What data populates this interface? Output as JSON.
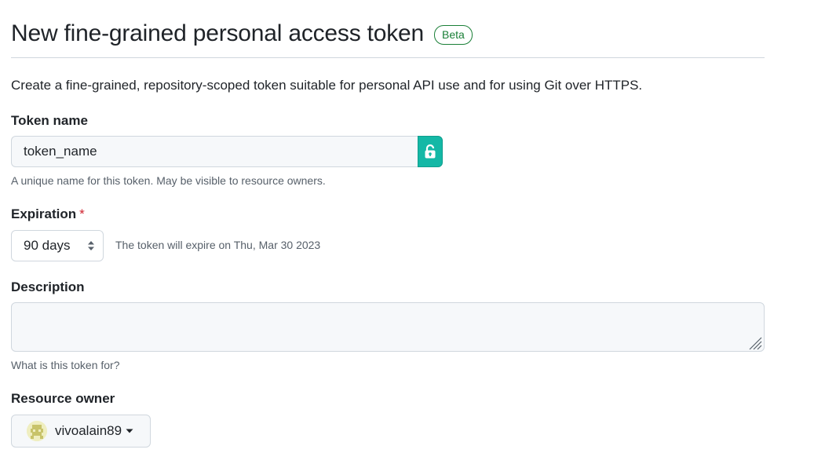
{
  "header": {
    "title": "New fine-grained personal access token",
    "badge": "Beta"
  },
  "intro": "Create a fine-grained, repository-scoped token suitable for personal API use and for using Git over HTTPS.",
  "token_name": {
    "label": "Token name",
    "value": "token_name",
    "hint": "A unique name for this token. May be visible to resource owners.",
    "icon": "lock-icon"
  },
  "expiration": {
    "label": "Expiration",
    "required_mark": "*",
    "selected": "90 days",
    "note": "The token will expire on Thu, Mar 30 2023"
  },
  "description": {
    "label": "Description",
    "value": "",
    "hint": "What is this token for?"
  },
  "resource_owner": {
    "label": "Resource owner",
    "selected": "vivoalain89",
    "icon": "avatar-icon"
  },
  "colors": {
    "accent_green": "#1a7f37",
    "lock_teal": "#14b8a6",
    "required_red": "#cf222e",
    "muted_text": "#57606a",
    "border": "#d0d7de"
  }
}
